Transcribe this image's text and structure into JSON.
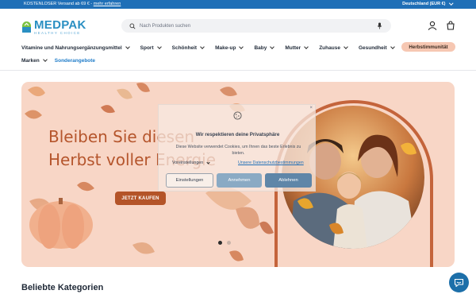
{
  "announcement": {
    "text": "KOSTENLOSER Versand ab 69 € - ",
    "link": "mehr erfahren",
    "country": "Deutschland (EUR €)"
  },
  "logo": {
    "name": "MEDPAK",
    "tagline": "HEALTHY CHOICE"
  },
  "search": {
    "placeholder": "Nach Produkten suchen"
  },
  "nav": {
    "row1": [
      {
        "label": "Vitamine und Nahrungsergänzungsmittel",
        "dropdown": true
      },
      {
        "label": "Sport",
        "dropdown": true
      },
      {
        "label": "Schönheit",
        "dropdown": true
      },
      {
        "label": "Make-up",
        "dropdown": true
      },
      {
        "label": "Baby",
        "dropdown": true
      },
      {
        "label": "Mutter",
        "dropdown": true
      },
      {
        "label": "Zuhause",
        "dropdown": true
      },
      {
        "label": "Gesundheit",
        "dropdown": true
      }
    ],
    "highlight": "Herbstimmunität",
    "row2": [
      {
        "label": "Marken",
        "dropdown": true
      },
      {
        "label": "Sonderangebote",
        "dropdown": false
      }
    ]
  },
  "hero": {
    "title_line1": "Bleiben Sie diesen",
    "title_line2": "Herbst voller Energie",
    "cta": "JETZT KAUFEN",
    "slides_total": 2,
    "slide_active": 1
  },
  "cookie": {
    "title": "Wir respektieren deine Privatsphäre",
    "text": "Diese Website verwendet Cookies, um Ihnen das beste Erlebnis zu bieten.",
    "preferences_label": "Voreinstellungen",
    "policy_link": "Unsere Datenschutzbestimmungen",
    "buttons": {
      "settings": "Einstellungen",
      "accept": "Annehmen",
      "reject": "Ablehnen"
    }
  },
  "section": {
    "title": "Beliebte Kategorien"
  },
  "colors": {
    "topbar": "#1f6fb7",
    "brand": "#2a8fc2",
    "hero_bg": "#f8d6c6",
    "hero_accent": "#b45428",
    "pill": "#f6c7b2",
    "chat": "#1c6fa9"
  }
}
